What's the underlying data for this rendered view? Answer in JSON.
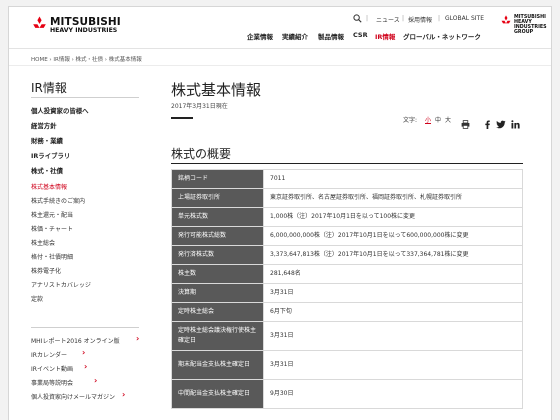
{
  "header": {
    "brand_line1": "MITSUBISHI",
    "brand_line2": "HEAVY INDUSTRIES",
    "util_links": [
      "ニュース",
      "採用情報",
      "GLOBAL SITE"
    ],
    "util_separator": "|",
    "nav": [
      {
        "label": "企業情報",
        "active": false
      },
      {
        "label": "実績紹介",
        "active": false
      },
      {
        "label": "製品情報",
        "active": false
      },
      {
        "label": "CSR",
        "active": false
      },
      {
        "label": "IR情報",
        "active": true
      },
      {
        "label": "グローバル・ネットワーク",
        "active": false
      }
    ],
    "group_logo": [
      "MITSUBISHI",
      "HEAVY",
      "INDUSTRIES",
      "GROUP"
    ]
  },
  "breadcrumb": "HOME › IR情報 › 株式・社債 › 株式基本情報",
  "sidebar": {
    "title": "IR情報",
    "items": [
      "個人投資家の皆様へ",
      "経営方針",
      "財務・業績",
      "IRライブラリ",
      "株式・社債"
    ],
    "subitems": [
      {
        "label": "株式基本情報",
        "active": true
      },
      {
        "label": "株式手続きのご案内",
        "active": false
      },
      {
        "label": "株主還元・配当",
        "active": false
      },
      {
        "label": "株価・チャート",
        "active": false
      },
      {
        "label": "株主総会",
        "active": false
      },
      {
        "label": "格付・社債明細",
        "active": false
      },
      {
        "label": "株券電子化",
        "active": false
      },
      {
        "label": "アナリストカバレッジ",
        "active": false
      },
      {
        "label": "定款",
        "active": false
      }
    ],
    "extra_links": [
      "MHIレポート2016 オンライン版",
      "IRカレンダー",
      "IRイベント動画",
      "事業局等説明会",
      "個人投資家向けメールマガジン"
    ]
  },
  "main": {
    "title": "株式基本情報",
    "date": "2017年3月31日現在",
    "font_size_label": "文字:",
    "font_size_options": [
      {
        "label": "小",
        "active": true
      },
      {
        "label": "中",
        "active": false
      },
      {
        "label": "大",
        "active": false
      }
    ],
    "section_title": "株式の概要",
    "table": [
      {
        "key": "銘柄コード",
        "value": "7011"
      },
      {
        "key": "上場証券取引所",
        "value": "東京証券取引所、名古屋証券取引所、福岡証券取引所、札幌証券取引所"
      },
      {
        "key": "単元株式数",
        "value": "1,000株（注）2017年10月1日を以って100株に変更"
      },
      {
        "key": "発行可能株式総数",
        "value": "6,000,000,000株（注）2017年10月1日を以って600,000,000株に変更"
      },
      {
        "key": "発行済株式数",
        "value": "3,373,647,813株（注）2017年10月1日を以って337,364,781株に変更"
      },
      {
        "key": "株主数",
        "value": "281,648名"
      },
      {
        "key": "決算期",
        "value": "3月31日"
      },
      {
        "key": "定時株主総会",
        "value": "6月下旬"
      },
      {
        "key": "定時株主総会議決権行使株主確定日",
        "value": "3月31日"
      },
      {
        "key": "期末配当金支払株主確定日",
        "value": "3月31日"
      },
      {
        "key": "中間配当金支払株主確定日",
        "value": "9月30日"
      }
    ]
  },
  "icons": [
    "mitsubishi-logo-icon",
    "search-icon",
    "print-icon",
    "facebook-icon",
    "twitter-icon",
    "linkedin-icon",
    "chevron-right-icon"
  ],
  "colors": {
    "accent": "#d0021b",
    "table_key_bg": "#595959"
  }
}
